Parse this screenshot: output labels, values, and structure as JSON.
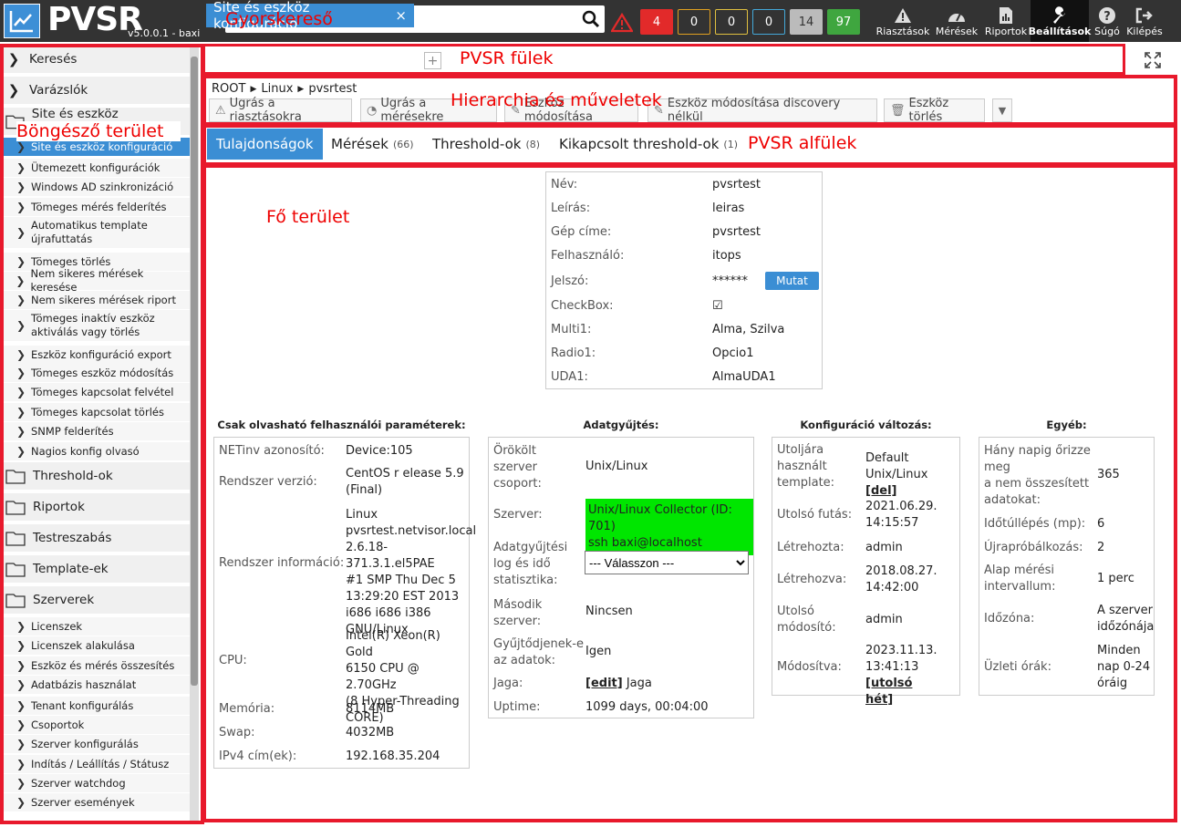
{
  "app": {
    "title": "PVSR",
    "version": "v5.0.0.1 - baxi"
  },
  "search": {
    "placeholder": ""
  },
  "counters": [
    {
      "value": "4",
      "bg": "#e22a2a",
      "fg": "#fff",
      "border": "#e22a2a"
    },
    {
      "value": "0",
      "bg": "#333",
      "fg": "#fff",
      "border": "#e0a020"
    },
    {
      "value": "0",
      "bg": "#333",
      "fg": "#fff",
      "border": "#e0c040"
    },
    {
      "value": "0",
      "bg": "#333",
      "fg": "#fff",
      "border": "#44a8d8"
    },
    {
      "value": "14",
      "bg": "#bbbbbb",
      "fg": "#333",
      "border": "#bbbbbb"
    },
    {
      "value": "97",
      "bg": "#3fa63f",
      "fg": "#fff",
      "border": "#3fa63f"
    }
  ],
  "nav": [
    {
      "label": "Riasztások",
      "icon": "warning-icon"
    },
    {
      "label": "Mérések",
      "icon": "gauge-icon"
    },
    {
      "label": "Riportok",
      "icon": "report-icon"
    },
    {
      "label": "Beállítások",
      "icon": "wrench-icon"
    },
    {
      "label": "Súgó",
      "icon": "help-icon"
    },
    {
      "label": "Kilépés",
      "icon": "logout-icon"
    }
  ],
  "annotations": {
    "search": "Gyorskereső",
    "tabs": "PVSR fülek",
    "hierarchy": "Hierarchia és műveletek",
    "browser": "Böngésző terület",
    "subtabs": "PVSR alfülek",
    "main": "Fő terület"
  },
  "sidebar": {
    "top": [
      "Keresés",
      "Varázslók",
      "Site és eszköz konfiguráció"
    ],
    "sub1": [
      "Site és eszköz konfiguráció",
      "Ütemezett konfigurációk",
      "Windows AD szinkronizáció",
      "Tömeges mérés felderítés",
      "Automatikus template",
      "újrafuttatás",
      "Tömeges törlés",
      "Nem sikeres mérések keresése",
      "Nem sikeres mérések riport",
      "Tömeges inaktív eszköz",
      "aktiválás vagy törlés",
      "Eszköz konfiguráció export",
      "Tömeges eszköz módosítás",
      "Tömeges kapcsolat felvétel",
      "Tömeges kapcsolat törlés",
      "SNMP felderítés",
      "Nagios konfig olvasó"
    ],
    "folders": [
      "Threshold-ok",
      "Riportok",
      "Testreszabás",
      "Template-ek",
      "Szerverek"
    ],
    "sub2": [
      "Licenszek",
      "Licenszek alakulása",
      "Eszköz és mérés összesítés",
      "Adatbázis használat",
      "Tenant konfigurálás",
      "Csoportok",
      "Szerver konfigurálás",
      "Indítás / Leállítás / Státusz",
      "Szerver watchdog",
      "Szerver események"
    ]
  },
  "tabs": {
    "main": "Site és eszköz konfiguráció",
    "close": "×",
    "add": "+"
  },
  "breadcrumb": [
    "ROOT",
    "Linux",
    "pvsrtest"
  ],
  "actions": [
    "Ugrás a riasztásokra",
    "Ugrás a mérésekre",
    "Eszköz módosítása",
    "Eszköz módosítása discovery nélkül",
    "Eszköz törlés"
  ],
  "subtabs": [
    {
      "label": "Tulajdonságok",
      "count": ""
    },
    {
      "label": "Mérések",
      "count": "(66)"
    },
    {
      "label": "Threshold-ok",
      "count": "(8)"
    },
    {
      "label": "Kikapcsolt threshold-ok",
      "count": "(1)"
    }
  ],
  "props": [
    {
      "label": "Név:",
      "value": "pvsrtest"
    },
    {
      "label": "Leírás:",
      "value": "leiras"
    },
    {
      "label": "Gép címe:",
      "value": "pvsrtest"
    },
    {
      "label": "Felhasználó:",
      "value": "itops"
    },
    {
      "label": "Jelszó:",
      "value": "******"
    },
    {
      "label": "CheckBox:",
      "value": "☑"
    },
    {
      "label": "Multi1:",
      "value": "Alma, Szilva"
    },
    {
      "label": "Radio1:",
      "value": "Opcio1"
    },
    {
      "label": "UDA1:",
      "value": "AlmaUDA1"
    }
  ],
  "mutat": "Mutat",
  "readonly": {
    "title": "Csak olvasható felhasználói paraméterek:",
    "rows": [
      {
        "label": "NETinv azonosító:",
        "value": [
          "Device:105"
        ]
      },
      {
        "label": "Rendszer verzió:",
        "value": [
          "CentOS r elease 5.9",
          "(Final)"
        ]
      },
      {
        "label": "Rendszer információ:",
        "value": [
          "Linux",
          "pvsrtest.netvisor.local",
          "2.6.18-371.3.1.el5PAE",
          "#1 SMP Thu Dec 5",
          "13:29:20 EST 2013",
          "i686 i686 i386",
          "GNU/Linux"
        ]
      },
      {
        "label": "CPU:",
        "value": [
          "Intel(R) Xeon(R) Gold",
          "6150 CPU @ 2.70GHz",
          "(8 Hyper-Threading",
          "CORE)"
        ]
      },
      {
        "label": "Memória:",
        "value": [
          "8114MB"
        ]
      },
      {
        "label": "Swap:",
        "value": [
          "4032MB"
        ]
      },
      {
        "label": "IPv4 cím(ek):",
        "value": [
          "192.168.35.204"
        ]
      }
    ]
  },
  "data_collection": {
    "title": "Adatgyűjtés:",
    "rows": [
      {
        "label": [
          "Örökölt",
          "szerver",
          "csoport:"
        ],
        "value": [
          "Unix/Linux"
        ]
      },
      {
        "label": [
          "Szerver:"
        ],
        "value": [
          "Unix/Linux Collector (ID: 701)",
          "ssh baxi@localhost"
        ]
      },
      {
        "label": [
          "Adatgyűjtési",
          "log és idő",
          "statisztika:"
        ],
        "value": [
          "--- Válasszon ---"
        ]
      },
      {
        "label": [
          "Második",
          "szerver:"
        ],
        "value": [
          "Nincsen"
        ]
      },
      {
        "label": [
          "Gyűjtődjenek-e",
          "az adatok:"
        ],
        "value": [
          "Igen"
        ]
      },
      {
        "label": [
          "Jaga:"
        ],
        "value": [
          "Jaga"
        ],
        "link": "[edit]"
      },
      {
        "label": [
          "Uptime:"
        ],
        "value": [
          "1099 days, 00:04:00"
        ]
      }
    ]
  },
  "config_change": {
    "title": "Konfiguráció változás:",
    "rows": [
      {
        "label": [
          "Utoljára",
          "használt",
          "template:"
        ],
        "value": [
          "Default",
          "Unix/Linux"
        ],
        "link": "[del]"
      },
      {
        "label": [
          "Utolsó futás:"
        ],
        "value": [
          "2021.06.29.",
          "14:15:57"
        ]
      },
      {
        "label": [
          "Létrehozta:"
        ],
        "value": [
          "admin"
        ]
      },
      {
        "label": [
          "Létrehozva:"
        ],
        "value": [
          "2018.08.27.",
          "14:42:00"
        ]
      },
      {
        "label": [
          "Utolsó",
          "módosító:"
        ],
        "value": [
          "admin"
        ]
      },
      {
        "label": [
          "Módosítva:"
        ],
        "value": [
          "2023.11.13.",
          "13:41:13"
        ],
        "link": [
          "[utolsó",
          "hét]"
        ]
      }
    ]
  },
  "other": {
    "title": "Egyéb:",
    "rows": [
      {
        "label": [
          "Hány napig őrizze",
          "meg",
          "a nem összesített",
          "adatokat:"
        ],
        "value": [
          "365"
        ]
      },
      {
        "label": [
          "Időtúllépés (mp):"
        ],
        "value": [
          "6"
        ]
      },
      {
        "label": [
          "Újrapróbálkozás:"
        ],
        "value": [
          "2"
        ]
      },
      {
        "label": [
          "Alap mérési",
          "intervallum:"
        ],
        "value": [
          "1 perc"
        ]
      },
      {
        "label": [
          "Időzóna:"
        ],
        "value": [
          "A szerver",
          "időzónája"
        ]
      },
      {
        "label": [
          "Üzleti órák:"
        ],
        "value": [
          "Minden",
          "nap 0-24",
          "óráig"
        ]
      }
    ]
  }
}
